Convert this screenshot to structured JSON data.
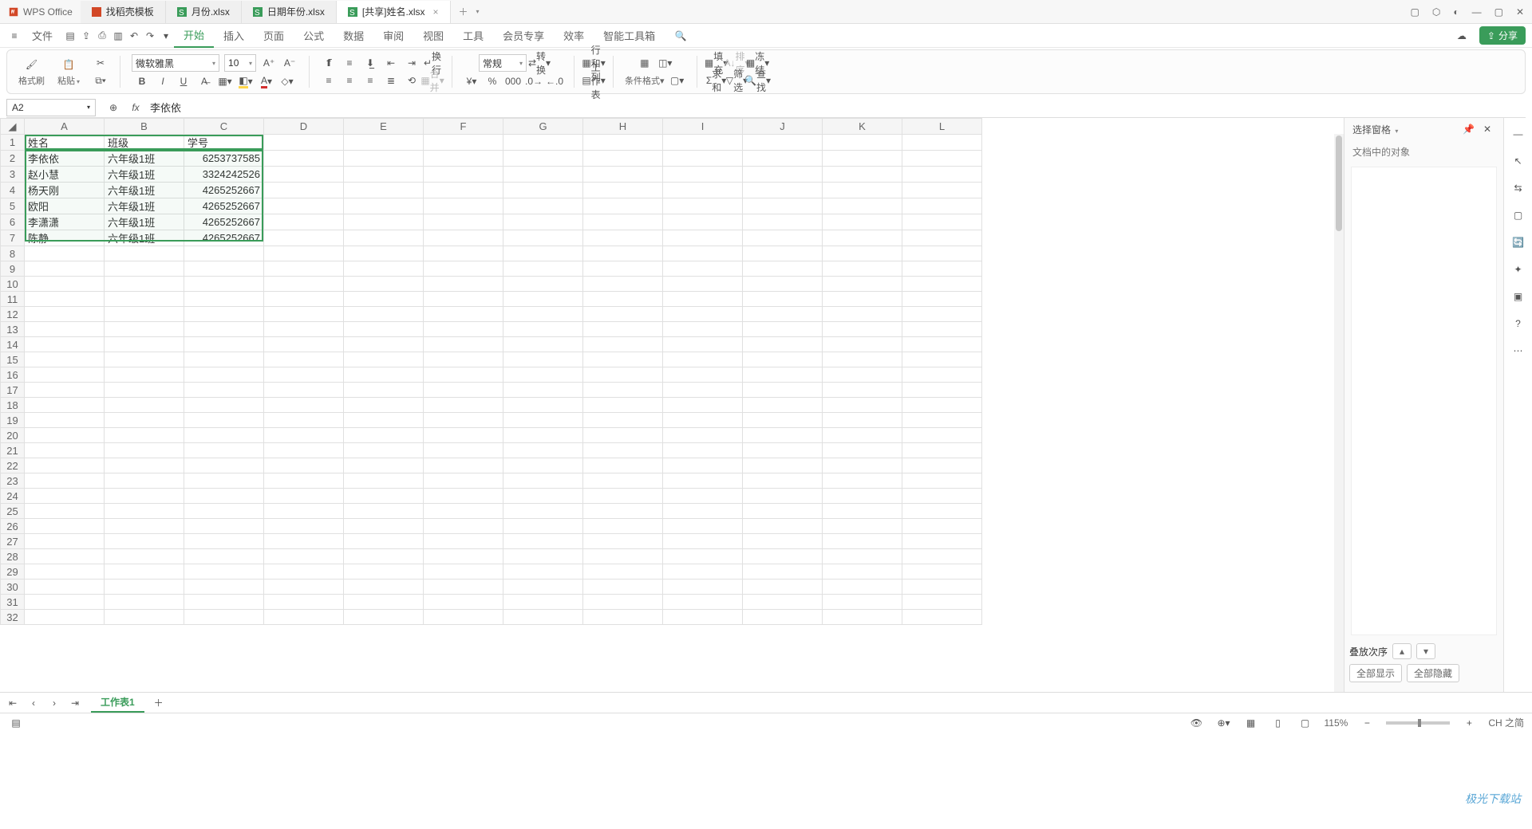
{
  "app": {
    "name": "WPS Office"
  },
  "tabs": [
    {
      "label": "找稻壳模板",
      "type": "d"
    },
    {
      "label": "月份.xlsx",
      "type": "s"
    },
    {
      "label": "日期年份.xlsx",
      "type": "s"
    },
    {
      "label": "[共享]姓名.xlsx",
      "type": "s",
      "active": true
    }
  ],
  "menus": [
    "文件"
  ],
  "ribbon_tabs": [
    "开始",
    "插入",
    "页面",
    "公式",
    "数据",
    "审阅",
    "视图",
    "工具",
    "会员专享",
    "效率",
    "智能工具箱"
  ],
  "active_ribbon": "开始",
  "toolbar": {
    "format_brush": "格式刷",
    "paste": "粘贴",
    "font": "微软雅黑",
    "font_size": "10",
    "number_format": "常规",
    "wrap": "换行",
    "convert": "转换",
    "rowcol": "行和列",
    "worksheet": "工作表",
    "cond": "条件格式",
    "merge": "合并",
    "fill": "填充",
    "sort": "排序",
    "freeze": "冻结",
    "sum": "求和",
    "filter": "筛选",
    "find": "查找"
  },
  "share": "分享",
  "namebox": "A2",
  "formula": "李依依",
  "columns": [
    "A",
    "B",
    "C",
    "D",
    "E",
    "F",
    "G",
    "H",
    "I",
    "J",
    "K",
    "L"
  ],
  "row_count": 32,
  "headers": {
    "a": "姓名",
    "b": "班级",
    "c": "学号"
  },
  "rows": [
    {
      "a": "李依依",
      "b": "六年级1班",
      "c": "6253737585"
    },
    {
      "a": "赵小慧",
      "b": "六年级1班",
      "c": "3324242526"
    },
    {
      "a": "杨天刚",
      "b": "六年级1班",
      "c": "4265252667"
    },
    {
      "a": "欧阳",
      "b": "六年级1班",
      "c": "4265252667"
    },
    {
      "a": "李潇潇",
      "b": "六年级1班",
      "c": "4265252667"
    },
    {
      "a": "陈静",
      "b": "六年级1班",
      "c": "4265252667"
    }
  ],
  "right_pane": {
    "title": "选择窗格",
    "subtitle": "文档中的对象",
    "stack": "叠放次序",
    "show_all": "全部显示",
    "hide_all": "全部隐藏"
  },
  "sheet_tab": "工作表1",
  "status": {
    "zoom": "115%",
    "ime": "CH 之简"
  },
  "watermark": "极光下载站"
}
